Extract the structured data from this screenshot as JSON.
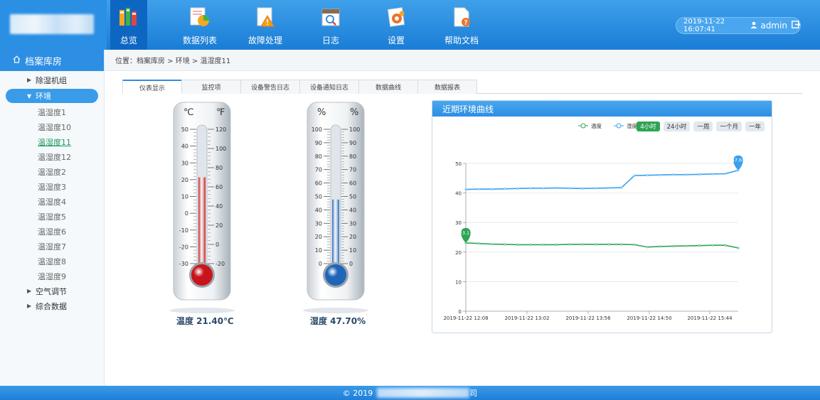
{
  "nav": {
    "items": [
      {
        "label": "总览",
        "icon": "books-icon"
      },
      {
        "label": "数据列表",
        "icon": "pie-chart-icon"
      },
      {
        "label": "故障处理",
        "icon": "warning-icon"
      },
      {
        "label": "日志",
        "icon": "calendar-search-icon"
      },
      {
        "label": "设置",
        "icon": "gear-icon"
      },
      {
        "label": "帮助文档",
        "icon": "help-document-icon"
      }
    ]
  },
  "header": {
    "datetime": "2019-11-22 16:07:41",
    "username": "admin"
  },
  "sidebar": {
    "title": "档案库房",
    "groups": [
      {
        "label": "除湿机组",
        "expanded": false
      },
      {
        "label": "环境",
        "expanded": true,
        "children": [
          "温湿度1",
          "温湿度10",
          "温湿度11",
          "温湿度12",
          "温湿度2",
          "温湿度3",
          "温湿度4",
          "温湿度5",
          "温湿度6",
          "温湿度7",
          "温湿度8",
          "温湿度9"
        ],
        "selected": "温湿度11"
      },
      {
        "label": "空气调节",
        "expanded": false
      },
      {
        "label": "综合数据",
        "expanded": false
      }
    ]
  },
  "breadcrumb": "位置：档案库房 > 环境 > 温湿度11",
  "tabs": [
    "仪表显示",
    "监控项",
    "设备警告日志",
    "设备通知日志",
    "数据曲线",
    "数据报表"
  ],
  "thermometers": {
    "temp": {
      "unit_left": "℃",
      "unit_right": "℉",
      "left_ticks": [
        "50",
        "40",
        "30",
        "20",
        "10",
        "0",
        "-10",
        "-20",
        "-30"
      ],
      "right_ticks": [
        "120",
        "100",
        "80",
        "60",
        "40",
        "20",
        "0",
        "-20"
      ],
      "value": 21.4,
      "min": -30,
      "max": 50,
      "label": "温度 21.40℃",
      "color": "#c8141a"
    },
    "hum": {
      "unit_left": "%",
      "unit_right": "%",
      "left_ticks": [
        "100",
        "90",
        "80",
        "70",
        "60",
        "50",
        "40",
        "30",
        "20",
        "10",
        "0"
      ],
      "right_ticks": [
        "100",
        "90",
        "80",
        "70",
        "60",
        "50",
        "40",
        "30",
        "20",
        "10",
        "0"
      ],
      "value": 47.7,
      "min": 0,
      "max": 100,
      "label": "湿度 47.70%",
      "color": "#1f66b8"
    }
  },
  "panel": {
    "title": "近期环境曲线",
    "ranges": [
      "4小时",
      "24小时",
      "一周",
      "一个月",
      "一年"
    ],
    "active_range": "4小时"
  },
  "chart_data": {
    "type": "line",
    "x": [
      "2019-11-22 12:08",
      "2019-11-22 13:02",
      "2019-11-22 13:56",
      "2019-11-22 14:50",
      "2019-11-22 15:44"
    ],
    "ylim": [
      0,
      50
    ],
    "yticks": [
      "0",
      "10",
      "20",
      "30",
      "40",
      "50"
    ],
    "legend_position": "top",
    "series": [
      {
        "name": "温度",
        "color": "#2ea455",
        "values": [
          23.1,
          22.9,
          22.7,
          22.6,
          22.5,
          22.5,
          22.5,
          22.5,
          22.6,
          22.6,
          22.6,
          22.6,
          22.6,
          22.5,
          21.7,
          21.9,
          22.0,
          22.1,
          22.2,
          22.3,
          22.3,
          21.4
        ],
        "marker_label": "23.11"
      },
      {
        "name": "湿度",
        "color": "#3aa0ee",
        "values": [
          41.2,
          41.3,
          41.3,
          41.4,
          41.5,
          41.6,
          41.6,
          41.7,
          41.6,
          41.5,
          41.6,
          41.7,
          41.8,
          45.9,
          46.0,
          46.1,
          46.2,
          46.2,
          46.3,
          46.4,
          46.5,
          47.67
        ],
        "marker_label": "47.67"
      }
    ]
  },
  "footer": {
    "copyright": "© 2019",
    "tail": "司"
  }
}
